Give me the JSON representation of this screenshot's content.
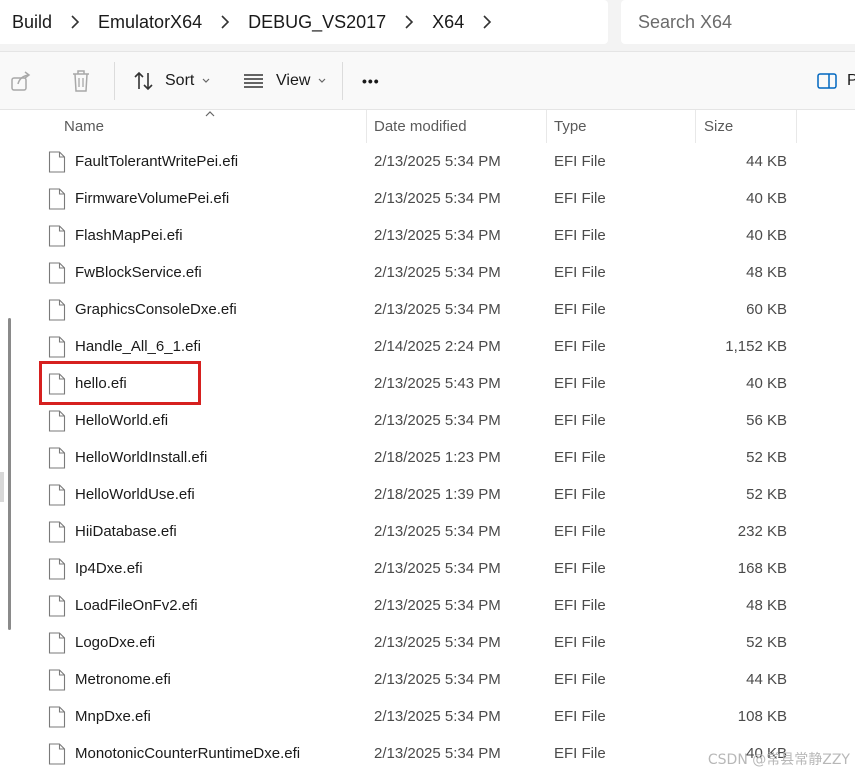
{
  "breadcrumb": [
    "Build",
    "EmulatorX64",
    "DEBUG_VS2017",
    "X64"
  ],
  "search": {
    "placeholder": "Search X64"
  },
  "toolbar": {
    "share_icon": "share-icon",
    "delete_icon": "trash-icon",
    "sort_label": "Sort",
    "view_label": "View",
    "more_label": "•••",
    "preview_partial": "P"
  },
  "columns": {
    "name": "Name",
    "date": "Date modified",
    "type": "Type",
    "size": "Size"
  },
  "files": [
    {
      "name": "FaultTolerantWritePei.efi",
      "date": "2/13/2025 5:34 PM",
      "type": "EFI File",
      "size": "44 KB"
    },
    {
      "name": "FirmwareVolumePei.efi",
      "date": "2/13/2025 5:34 PM",
      "type": "EFI File",
      "size": "40 KB"
    },
    {
      "name": "FlashMapPei.efi",
      "date": "2/13/2025 5:34 PM",
      "type": "EFI File",
      "size": "40 KB"
    },
    {
      "name": "FwBlockService.efi",
      "date": "2/13/2025 5:34 PM",
      "type": "EFI File",
      "size": "48 KB"
    },
    {
      "name": "GraphicsConsoleDxe.efi",
      "date": "2/13/2025 5:34 PM",
      "type": "EFI File",
      "size": "60 KB"
    },
    {
      "name": "Handle_All_6_1.efi",
      "date": "2/14/2025 2:24 PM",
      "type": "EFI File",
      "size": "1,152 KB"
    },
    {
      "name": "hello.efi",
      "date": "2/13/2025 5:43 PM",
      "type": "EFI File",
      "size": "40 KB",
      "highlighted": true
    },
    {
      "name": "HelloWorld.efi",
      "date": "2/13/2025 5:34 PM",
      "type": "EFI File",
      "size": "56 KB"
    },
    {
      "name": "HelloWorldInstall.efi",
      "date": "2/18/2025 1:23 PM",
      "type": "EFI File",
      "size": "52 KB"
    },
    {
      "name": "HelloWorldUse.efi",
      "date": "2/18/2025 1:39 PM",
      "type": "EFI File",
      "size": "52 KB"
    },
    {
      "name": "HiiDatabase.efi",
      "date": "2/13/2025 5:34 PM",
      "type": "EFI File",
      "size": "232 KB"
    },
    {
      "name": "Ip4Dxe.efi",
      "date": "2/13/2025 5:34 PM",
      "type": "EFI File",
      "size": "168 KB"
    },
    {
      "name": "LoadFileOnFv2.efi",
      "date": "2/13/2025 5:34 PM",
      "type": "EFI File",
      "size": "48 KB"
    },
    {
      "name": "LogoDxe.efi",
      "date": "2/13/2025 5:34 PM",
      "type": "EFI File",
      "size": "52 KB"
    },
    {
      "name": "Metronome.efi",
      "date": "2/13/2025 5:34 PM",
      "type": "EFI File",
      "size": "44 KB"
    },
    {
      "name": "MnpDxe.efi",
      "date": "2/13/2025 5:34 PM",
      "type": "EFI File",
      "size": "108 KB"
    },
    {
      "name": "MonotonicCounterRuntimeDxe.efi",
      "date": "2/13/2025 5:34 PM",
      "type": "EFI File",
      "size": "40 KB"
    }
  ],
  "watermark": "CSDN @常县常静ZZY",
  "colors": {
    "highlight_border": "#d6201f",
    "accent": "#0067c0"
  }
}
